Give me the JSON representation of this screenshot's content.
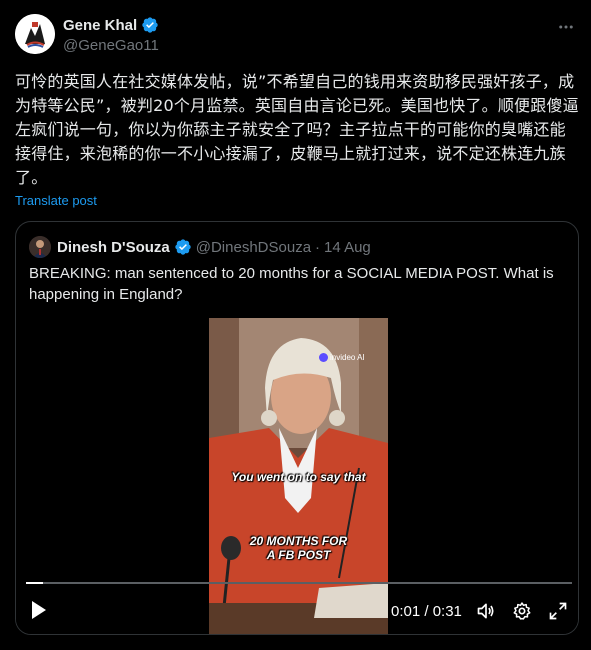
{
  "post": {
    "author_name": "Gene Khal",
    "author_handle": "@GeneGao11",
    "text": "可怜的英国人在社交媒体发帖，说”不希望自己的钱用来资助移民强奸孩子，成为特等公民”，被判20个月监禁。英国自由言论已死。美国也快了。顺便跟傻逼左疯们说一句，你以为你舔主子就安全了吗？主子拉点干的可能你的臭嘴还能接得住，来泡稀的你一不小心接漏了，皮鞭马上就打过来，说不定还株连九族了。",
    "translate_label": "Translate post"
  },
  "quote": {
    "author_name": "Dinesh D'Souza",
    "author_handle": "@DineshDSouza",
    "separator": "·",
    "date": "14 Aug",
    "text": "BREAKING: man sentenced to 20 months for a SOCIAL MEDIA POST. What is happening in England?"
  },
  "video": {
    "watermark": "invideo AI",
    "caption_top": "You went on to say that",
    "caption_bottom_1": "20 MONTHS FOR",
    "caption_bottom_2": "A FB POST",
    "time_display": "0:01 / 0:31",
    "progress_fraction": 0.032
  },
  "colors": {
    "background": "#000000",
    "text_primary": "#e7e9ea",
    "text_secondary": "#71767b",
    "accent": "#1d9bf0",
    "border": "#2f3336"
  },
  "icons": {
    "more": "more-horizontal-icon",
    "verified": "verified-badge-icon",
    "play": "play-icon",
    "volume": "volume-icon",
    "settings": "gear-icon",
    "fullscreen": "fullscreen-icon"
  }
}
